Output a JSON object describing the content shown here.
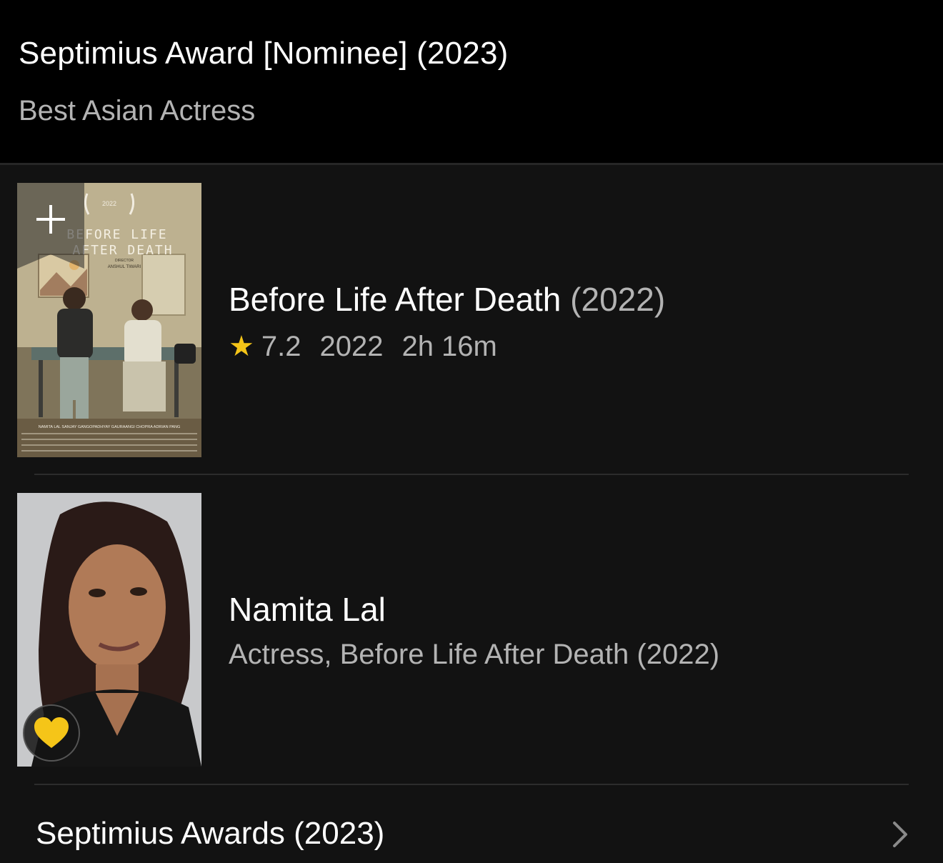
{
  "header": {
    "title": "Septimius Award [Nominee] (2023)",
    "subtitle": "Best Asian Actress"
  },
  "movie": {
    "title": "Before Life After Death",
    "year_paren": "(2022)",
    "rating": "7.2",
    "year": "2022",
    "runtime": "2h 16m",
    "poster": {
      "title_line1": "BEFORE LIFE",
      "title_line2": "AFTER DEATH",
      "laurel_year": "2022",
      "director_label": "DIRECTOR",
      "director": "ANSHUL TIWARI",
      "cast_credits": "NAMITA LAL   SANJAY GANGOPADHYAY   GAURAANGI CHOPRA   ADRIAN PANG"
    },
    "icons": {
      "rating": "star-icon",
      "watchlist": "plus-icon"
    }
  },
  "person": {
    "name": "Namita Lal",
    "role": "Actress, Before Life After Death (2022)",
    "icons": {
      "favorite": "heart-icon"
    }
  },
  "footer": {
    "label": "Septimius Awards (2023)",
    "icon": "chevron-right-icon"
  },
  "colors": {
    "background": "#121212",
    "header_background": "#000000",
    "accent": "#f5c518",
    "secondary_text": "#b3b3b3"
  }
}
